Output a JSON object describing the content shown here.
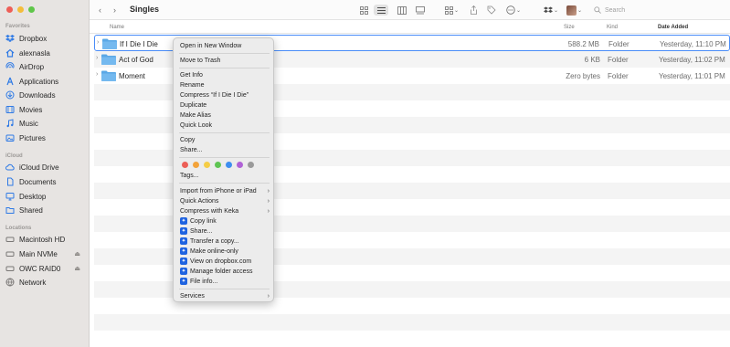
{
  "sidebar": {
    "favorites_title": "Favorites",
    "favorites": [
      {
        "label": "Dropbox",
        "icon": "dropbox-icon"
      },
      {
        "label": "alexnasla",
        "icon": "home-icon"
      },
      {
        "label": "AirDrop",
        "icon": "airdrop-icon"
      },
      {
        "label": "Applications",
        "icon": "applications-icon"
      },
      {
        "label": "Downloads",
        "icon": "downloads-icon"
      },
      {
        "label": "Movies",
        "icon": "movies-icon"
      },
      {
        "label": "Music",
        "icon": "music-icon"
      },
      {
        "label": "Pictures",
        "icon": "pictures-icon"
      }
    ],
    "icloud_title": "iCloud",
    "icloud": [
      {
        "label": "iCloud Drive",
        "icon": "cloud-icon"
      },
      {
        "label": "Documents",
        "icon": "document-icon"
      },
      {
        "label": "Desktop",
        "icon": "desktop-icon"
      },
      {
        "label": "Shared",
        "icon": "shared-folder-icon"
      }
    ],
    "locations_title": "Locations",
    "locations": [
      {
        "label": "Macintosh HD",
        "icon": "disk-icon"
      },
      {
        "label": "Main NVMe",
        "icon": "disk-icon"
      },
      {
        "label": "OWC RAID0",
        "icon": "disk-icon"
      },
      {
        "label": "Network",
        "icon": "network-icon"
      }
    ]
  },
  "toolbar": {
    "title": "Singles",
    "search_placeholder": "Search"
  },
  "columns": {
    "name": "Name",
    "size": "Size",
    "kind": "Kind",
    "date": "Date Added"
  },
  "files": [
    {
      "name": "If I Die I Die",
      "size": "588.2 MB",
      "kind": "Folder",
      "date": "Yesterday, 11:10 PM"
    },
    {
      "name": "Act of God",
      "size": "6 KB",
      "kind": "Folder",
      "date": "Yesterday, 11:02 PM"
    },
    {
      "name": "Moment",
      "size": "Zero bytes",
      "kind": "Folder",
      "date": "Yesterday, 11:01 PM"
    }
  ],
  "context_menu": {
    "open_new_window": "Open in New Window",
    "move_to_trash": "Move to Trash",
    "get_info": "Get Info",
    "rename": "Rename",
    "compress": "Compress “If I Die I Die”",
    "duplicate": "Duplicate",
    "make_alias": "Make Alias",
    "quick_look": "Quick Look",
    "copy": "Copy",
    "share": "Share...",
    "tags": "Tags...",
    "import_iphone": "Import from iPhone or iPad",
    "quick_actions": "Quick Actions",
    "compress_keka": "Compress with Keka",
    "dbx_copy_link": "Copy link",
    "dbx_share": "Share...",
    "dbx_transfer": "Transfer a copy...",
    "dbx_online_only": "Make online-only",
    "dbx_view": "View on dropbox.com",
    "dbx_manage": "Manage folder access",
    "dbx_file_info": "File info...",
    "services": "Services",
    "tag_colors": [
      "#ec5f57",
      "#f3a33a",
      "#f5cd46",
      "#5fc553",
      "#3d8ef0",
      "#b062d6",
      "#9a9a9a"
    ]
  },
  "colors": {
    "accent": "#4a8df8",
    "folder": "#5aa8e6",
    "dropbox": "#1f63e0"
  }
}
